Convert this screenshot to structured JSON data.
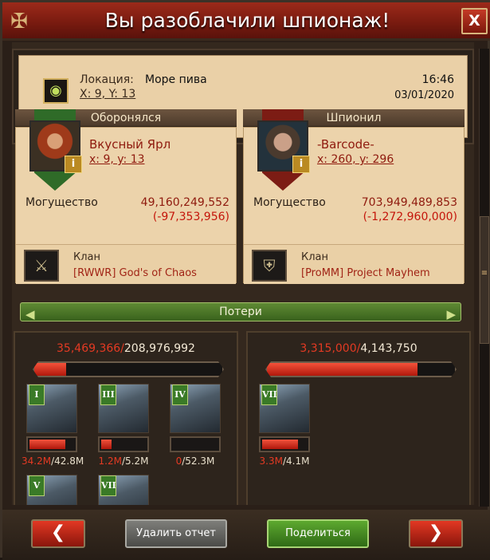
{
  "title": "Вы разоблачили шпионаж!",
  "close_label": "X",
  "location": {
    "label": "Локация:",
    "name": "Море пива",
    "coords": "X: 9, Y: 13",
    "time": "16:46",
    "date": "03/01/2020",
    "icon": "spy-eye-icon"
  },
  "defender": {
    "header": "Оборонялся",
    "name": "Вкусный Ярл",
    "coords": "x: 9, y: 13",
    "might_label": "Могущество",
    "might": "49,160,249,552",
    "might_delta": "(-97,353,956)",
    "clan_label": "Клан",
    "clan": "[RWWR] God's of Chaos",
    "banner_color": "#2f6b28"
  },
  "attacker": {
    "header": "Шпионил",
    "name": "-Barcode-",
    "coords": "x: 260, y: 296",
    "might_label": "Могущество",
    "might": "703,949,489,853",
    "might_delta": "(-1,272,960,000)",
    "clan_label": "Клан",
    "clan": "[ProMM] Project Mayhem",
    "banner_color": "#7c1c14"
  },
  "losses_title": "Потери",
  "left_losses": {
    "lost": "35,469,366/",
    "total": "208,976,992",
    "bar_fraction": 0.17,
    "units": [
      {
        "tier": "I",
        "lost": "34.2M",
        "total": "/42.8M",
        "fraction": 0.8
      },
      {
        "tier": "III",
        "lost": "1.2M",
        "total": "/5.2M",
        "fraction": 0.23
      },
      {
        "tier": "IV",
        "lost": "0",
        "total": "/52.3M",
        "fraction": 0.0
      },
      {
        "tier": "V",
        "lost": "",
        "total": "",
        "fraction": 0
      },
      {
        "tier": "VII",
        "lost": "",
        "total": "",
        "fraction": 0
      }
    ]
  },
  "right_losses": {
    "lost": "3,315,000/",
    "total": "4,143,750",
    "bar_fraction": 0.8,
    "units": [
      {
        "tier": "VII",
        "lost": "3.3M",
        "total": "/4.1M",
        "fraction": 0.8
      }
    ]
  },
  "buttons": {
    "prev": "❮",
    "delete": "Удалить отчет",
    "share": "Поделиться",
    "next": "❯"
  }
}
